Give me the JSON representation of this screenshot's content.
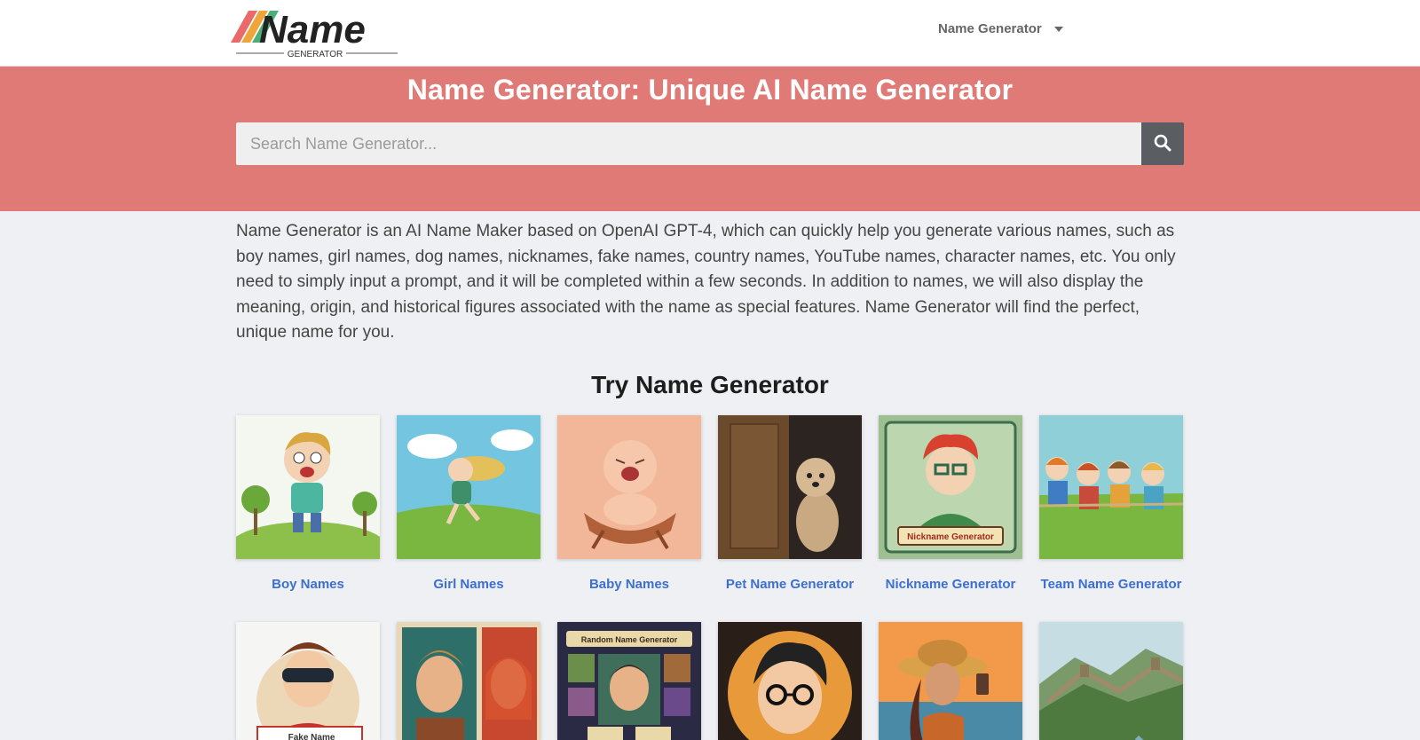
{
  "header": {
    "logo_text": "Name",
    "logo_subtext": "GENERATOR",
    "nav": {
      "label": "Name Generator"
    }
  },
  "hero": {
    "title": "Name Generator: Unique AI Name Generator",
    "search": {
      "placeholder": "Search Name Generator...",
      "value": ""
    },
    "search_icon": "search-icon"
  },
  "intro": {
    "text": "Name Generator is an AI Name Maker based on OpenAI GPT-4, which can quickly help you generate various names, such as boy names, girl names, dog names, nicknames, fake names, country names, YouTube names, character names, etc. You only need to simply input a prompt, and it will be completed within a few seconds. In addition to names, we will also display the meaning, origin, and historical figures associated with the name as special features. Name Generator will find the perfect, unique name for you."
  },
  "tools": {
    "title": "Try Name Generator",
    "row1": [
      {
        "label": "Boy Names"
      },
      {
        "label": "Girl Names"
      },
      {
        "label": "Baby Names"
      },
      {
        "label": "Pet Name Generator"
      },
      {
        "label": "Nickname Generator",
        "image_text": "Nickname Generator"
      },
      {
        "label": "Team Name Generator"
      }
    ],
    "row2": [
      {
        "image_text": "Fake Name"
      },
      {
        "image_text": ""
      },
      {
        "image_text": "Random Name Generator"
      },
      {
        "image_text": ""
      },
      {
        "image_text": ""
      },
      {
        "image_text": ""
      }
    ]
  },
  "colors": {
    "hero_bg": "#df7a77",
    "link": "#3c6fd1",
    "search_button": "#5a5d62",
    "page_bg": "#eef0f3"
  }
}
